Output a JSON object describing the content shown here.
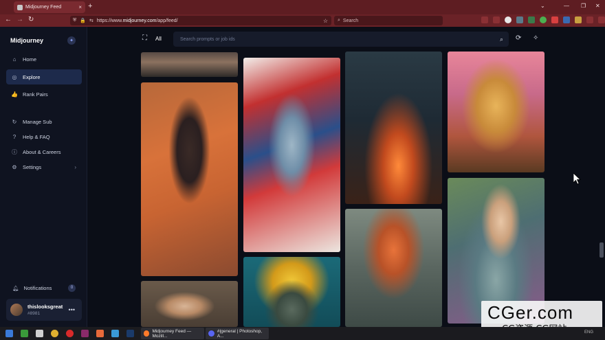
{
  "browser": {
    "tab_title": "Midjourney Feed",
    "tab_close": "×",
    "new_tab": "+",
    "url_prefix": "https://www.",
    "url_host": "midjourney.com",
    "url_path": "/app/feed/",
    "search_placeholder": "Search",
    "window_controls": {
      "dropdown": "⌄",
      "minimize": "—",
      "maximize": "❐",
      "close": "✕"
    }
  },
  "sidebar": {
    "brand": "Midjourney",
    "nav": [
      {
        "label": "Home",
        "icon": "home-icon",
        "glyph": "⌂"
      },
      {
        "label": "Explore",
        "icon": "compass-icon",
        "glyph": "◎"
      },
      {
        "label": "Rank Pairs",
        "icon": "thumbs-up-icon",
        "glyph": "👍"
      },
      {
        "label": "Manage Sub",
        "icon": "refresh-icon",
        "glyph": "↻"
      },
      {
        "label": "Help & FAQ",
        "icon": "help-icon",
        "glyph": "?"
      },
      {
        "label": "About & Careers",
        "icon": "info-icon",
        "glyph": "ⓘ"
      },
      {
        "label": "Settings",
        "icon": "gear-icon",
        "glyph": "⚙"
      }
    ],
    "notifications": {
      "label": "Notifications",
      "count": "0"
    },
    "user": {
      "name": "thislooksgreat",
      "tag": "#8981",
      "more": "•••"
    }
  },
  "feed": {
    "filter_label": "All",
    "search_placeholder": "Search prompts or job ids"
  },
  "watermark": {
    "big": "CGer.com",
    "small": "CG资源 CG网站"
  },
  "taskbar": {
    "apps": [
      {
        "label": "Midjourney Feed — Mozill...",
        "color": "#ff7b2a"
      },
      {
        "label": "#|general | Photoshop, A...",
        "color": "#5865f2"
      }
    ],
    "tray": "ENG"
  }
}
